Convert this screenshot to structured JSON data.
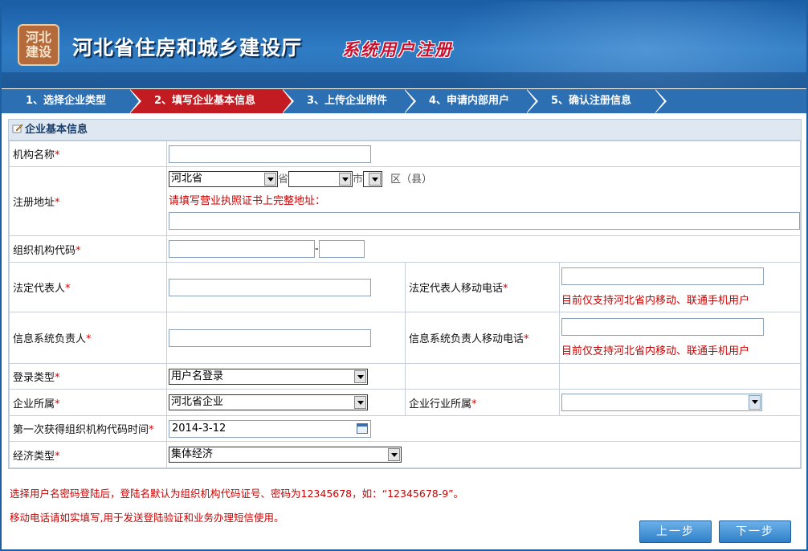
{
  "header": {
    "logo_text": "河北建设",
    "site_title": "河北省住房和城乡建设厅",
    "sub_title": "系统用户注册"
  },
  "steps": [
    {
      "label": "1、选择企业类型",
      "active": false
    },
    {
      "label": "2、填写企业基本信息",
      "active": true
    },
    {
      "label": "3、上传企业附件",
      "active": false
    },
    {
      "label": "4、申请内部用户",
      "active": false
    },
    {
      "label": "5、确认注册信息",
      "active": false
    }
  ],
  "form": {
    "section_title": "企业基本信息",
    "required_mark": "*",
    "org_name_label": "机构名称",
    "address_label": "注册地址",
    "province_value": "河北省",
    "province_unit": "省",
    "city_value": "",
    "city_unit": "市",
    "district_value": "",
    "district_unit": "区（县）",
    "address_hint": "请填写营业执照证书上完整地址：",
    "org_code_label": "组织机构代码",
    "org_code_sep": "-",
    "legal_rep_label": "法定代表人",
    "legal_phone_label": "法定代表人移动电话",
    "phone_hint": "目前仅支持河北省内移动、联通手机用户",
    "sys_manager_label": "信息系统负责人",
    "sys_phone_label": "信息系统负责人移动电话",
    "login_type_label": "登录类型",
    "login_type_value": "用户名登录",
    "belong_label": "企业所属",
    "belong_value": "河北省企业",
    "industry_label": "企业行业所属",
    "industry_value": "",
    "first_code_time_label": "第一次获得组织机构代码时间",
    "first_code_time_value": "2014-3-12",
    "economy_label": "经济类型",
    "economy_value": "集体经济"
  },
  "notes": [
    "选择用户名密码登陆后，登陆名默认为组织机构代码证号、密码为12345678，如：“12345678-9”。",
    "移动电话请如实填写,用于发送登陆验证和业务办理短信使用。"
  ],
  "buttons": {
    "prev": "上一步",
    "next": "下一步"
  }
}
